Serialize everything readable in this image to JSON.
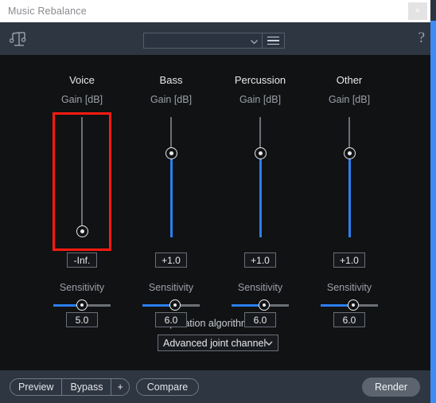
{
  "window": {
    "title": "Music Rebalance",
    "close_label": "×"
  },
  "toolbar": {
    "logo_icon": "music-balance-icon",
    "preset_value": "",
    "preset_placeholder": "",
    "menu_icon": "hamburger-menu-icon",
    "help_label": "?"
  },
  "stems": [
    {
      "name": "Voice",
      "gain_label": "Gain [dB]",
      "gain_value": "-Inf.",
      "gain_knob_pct": 96,
      "fill_pct": 0,
      "highlighted": true,
      "sensitivity_label": "Sensitivity",
      "sensitivity_value": "5.0",
      "sensitivity_pct": 50
    },
    {
      "name": "Bass",
      "gain_label": "Gain [dB]",
      "gain_value": "+1.0",
      "gain_knob_pct": 27,
      "fill_pct": 73,
      "highlighted": false,
      "sensitivity_label": "Sensitivity",
      "sensitivity_value": "6.0",
      "sensitivity_pct": 56
    },
    {
      "name": "Percussion",
      "gain_label": "Gain [dB]",
      "gain_value": "+1.0",
      "gain_knob_pct": 27,
      "fill_pct": 73,
      "highlighted": false,
      "sensitivity_label": "Sensitivity",
      "sensitivity_value": "6.0",
      "sensitivity_pct": 56
    },
    {
      "name": "Other",
      "gain_label": "Gain [dB]",
      "gain_value": "+1.0",
      "gain_knob_pct": 27,
      "fill_pct": 73,
      "highlighted": false,
      "sensitivity_label": "Sensitivity",
      "sensitivity_value": "6.0",
      "sensitivity_pct": 56
    }
  ],
  "separation": {
    "label": "Separation algorithm",
    "value": "Advanced joint channel"
  },
  "footer": {
    "preview_label": "Preview",
    "bypass_label": "Bypass",
    "plus_label": "+",
    "compare_label": "Compare",
    "render_label": "Render"
  },
  "colors": {
    "accent_blue": "#2b7ff0",
    "highlight_red": "#fd1a11",
    "toolbar_bg": "#2e3642",
    "panel_bg": "#111214",
    "titlebar_bg": "#ffffff"
  }
}
